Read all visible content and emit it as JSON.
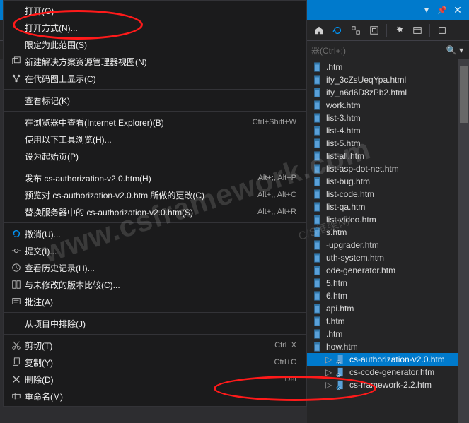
{
  "watermark": {
    "main": "www.csframework.com",
    "sub": "C/S框架网"
  },
  "searchbar": {
    "placeholder": "器(Ctrl+;)"
  },
  "context_menu": [
    {
      "type": "item",
      "icon": "",
      "label": "打开(O)",
      "shortcut": ""
    },
    {
      "type": "item",
      "icon": "",
      "label": "打开方式(N)...",
      "shortcut": ""
    },
    {
      "type": "item",
      "icon": "",
      "label": "限定为此范围(S)",
      "shortcut": ""
    },
    {
      "type": "item",
      "icon": "new-view",
      "label": "新建解决方案资源管理器视图(N)",
      "shortcut": ""
    },
    {
      "type": "item",
      "icon": "codemap",
      "label": "在代码图上显示(C)",
      "shortcut": ""
    },
    {
      "type": "sep"
    },
    {
      "type": "item",
      "icon": "",
      "label": "查看标记(K)",
      "shortcut": ""
    },
    {
      "type": "sep"
    },
    {
      "type": "item",
      "icon": "",
      "label": "在浏览器中查看(Internet Explorer)(B)",
      "shortcut": "Ctrl+Shift+W"
    },
    {
      "type": "item",
      "icon": "",
      "label": "使用以下工具浏览(H)...",
      "shortcut": ""
    },
    {
      "type": "item",
      "icon": "",
      "label": "设为起始页(P)",
      "shortcut": ""
    },
    {
      "type": "sep"
    },
    {
      "type": "item",
      "icon": "",
      "label": "发布 cs-authorization-v2.0.htm(H)",
      "shortcut": "Alt+;, Alt+P"
    },
    {
      "type": "item",
      "icon": "",
      "label": "预览对 cs-authorization-v2.0.htm 所做的更改(C)",
      "shortcut": "Alt+;, Alt+C"
    },
    {
      "type": "item",
      "icon": "",
      "label": "替换服务器中的 cs-authorization-v2.0.htm(S)",
      "shortcut": "Alt+;, Alt+R"
    },
    {
      "type": "sep"
    },
    {
      "type": "item",
      "icon": "undo",
      "label": "撤消(U)...",
      "shortcut": ""
    },
    {
      "type": "item",
      "icon": "commit",
      "label": "提交(I)...",
      "shortcut": ""
    },
    {
      "type": "item",
      "icon": "history",
      "label": "查看历史记录(H)...",
      "shortcut": ""
    },
    {
      "type": "item",
      "icon": "compare",
      "label": "与未修改的版本比较(C)...",
      "shortcut": ""
    },
    {
      "type": "item",
      "icon": "annotate",
      "label": "批注(A)",
      "shortcut": ""
    },
    {
      "type": "sep"
    },
    {
      "type": "item",
      "icon": "",
      "label": "从项目中排除(J)",
      "shortcut": ""
    },
    {
      "type": "sep"
    },
    {
      "type": "item",
      "icon": "cut",
      "label": "剪切(T)",
      "shortcut": "Ctrl+X"
    },
    {
      "type": "item",
      "icon": "copy",
      "label": "复制(Y)",
      "shortcut": "Ctrl+C"
    },
    {
      "type": "item",
      "icon": "delete",
      "label": "删除(D)",
      "shortcut": "Del"
    },
    {
      "type": "item",
      "icon": "rename",
      "label": "重命名(M)",
      "shortcut": ""
    }
  ],
  "files": [
    {
      "name": ".htm",
      "selected": false
    },
    {
      "name": "ify_3cZsUeqYpa.html",
      "selected": false
    },
    {
      "name": "ify_n6d6D8zPb2.html",
      "selected": false
    },
    {
      "name": "work.htm",
      "selected": false
    },
    {
      "name": "list-3.htm",
      "selected": false
    },
    {
      "name": "list-4.htm",
      "selected": false
    },
    {
      "name": "list-5.htm",
      "selected": false
    },
    {
      "name": "list-all.htm",
      "selected": false
    },
    {
      "name": "list-asp-dot-net.htm",
      "selected": false
    },
    {
      "name": "list-bug.htm",
      "selected": false
    },
    {
      "name": "list-code.htm",
      "selected": false
    },
    {
      "name": "list-qa.htm",
      "selected": false
    },
    {
      "name": "list-video.htm",
      "selected": false
    },
    {
      "name": "s.htm",
      "selected": false
    },
    {
      "name": "-upgrader.htm",
      "selected": false
    },
    {
      "name": "uth-system.htm",
      "selected": false
    },
    {
      "name": "ode-generator.htm",
      "selected": false
    },
    {
      "name": "5.htm",
      "selected": false
    },
    {
      "name": "6.htm",
      "selected": false
    },
    {
      "name": "api.htm",
      "selected": false
    },
    {
      "name": "t.htm",
      "selected": false
    },
    {
      "name": ".htm",
      "selected": false
    },
    {
      "name": "how.htm",
      "selected": false
    },
    {
      "name": "cs-authorization-v2.0.htm",
      "selected": true,
      "full": true
    },
    {
      "name": "cs-code-generator.htm",
      "selected": false,
      "full": true
    },
    {
      "name": "cs-framework-2.2.htm",
      "selected": false,
      "full": true
    }
  ]
}
